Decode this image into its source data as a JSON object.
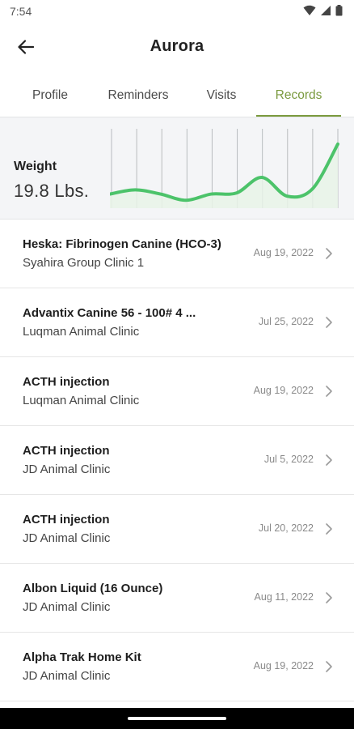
{
  "status_bar": {
    "time": "7:54",
    "icons": [
      "wifi-icon",
      "signal-icon",
      "battery-icon"
    ]
  },
  "app_bar": {
    "title": "Aurora",
    "back_icon": "back-arrow-icon"
  },
  "tabs": [
    {
      "label": "Profile",
      "active": false
    },
    {
      "label": "Reminders",
      "active": false
    },
    {
      "label": "Visits",
      "active": false
    },
    {
      "label": "Records",
      "active": true
    }
  ],
  "weight": {
    "label": "Weight",
    "value": "19.8 Lbs."
  },
  "chart_data": {
    "type": "area",
    "title": "",
    "xlabel": "",
    "ylabel": "",
    "grid": "vertical",
    "line_color": "#4cc36a",
    "fill_color": "#e7f3e8",
    "series": [
      {
        "values": [
          12,
          16,
          12,
          6,
          12,
          13,
          28,
          10,
          17,
          60
        ]
      }
    ],
    "ylim": [
      0,
      70
    ]
  },
  "records": [
    {
      "title": "Heska: Fibrinogen Canine (HCO-3)",
      "clinic": "Syahira Group Clinic 1",
      "date": "Aug 19, 2022"
    },
    {
      "title": "Advantix Canine 56 - 100# 4 ...",
      "clinic": "Luqman Animal Clinic",
      "date": "Jul 25, 2022"
    },
    {
      "title": "ACTH injection",
      "clinic": "Luqman Animal Clinic",
      "date": "Aug 19, 2022"
    },
    {
      "title": "ACTH injection",
      "clinic": "JD Animal Clinic",
      "date": "Jul 5, 2022"
    },
    {
      "title": "ACTH injection",
      "clinic": "JD Animal Clinic",
      "date": "Jul 20, 2022"
    },
    {
      "title": "Albon Liquid (16 Ounce)",
      "clinic": "JD Animal Clinic",
      "date": "Aug 11, 2022"
    },
    {
      "title": "Alpha Trak Home Kit",
      "clinic": "JD Animal Clinic",
      "date": "Aug 19, 2022"
    }
  ],
  "colors": {
    "accent": "#7a9a3e",
    "chart_line": "#4cc36a"
  }
}
